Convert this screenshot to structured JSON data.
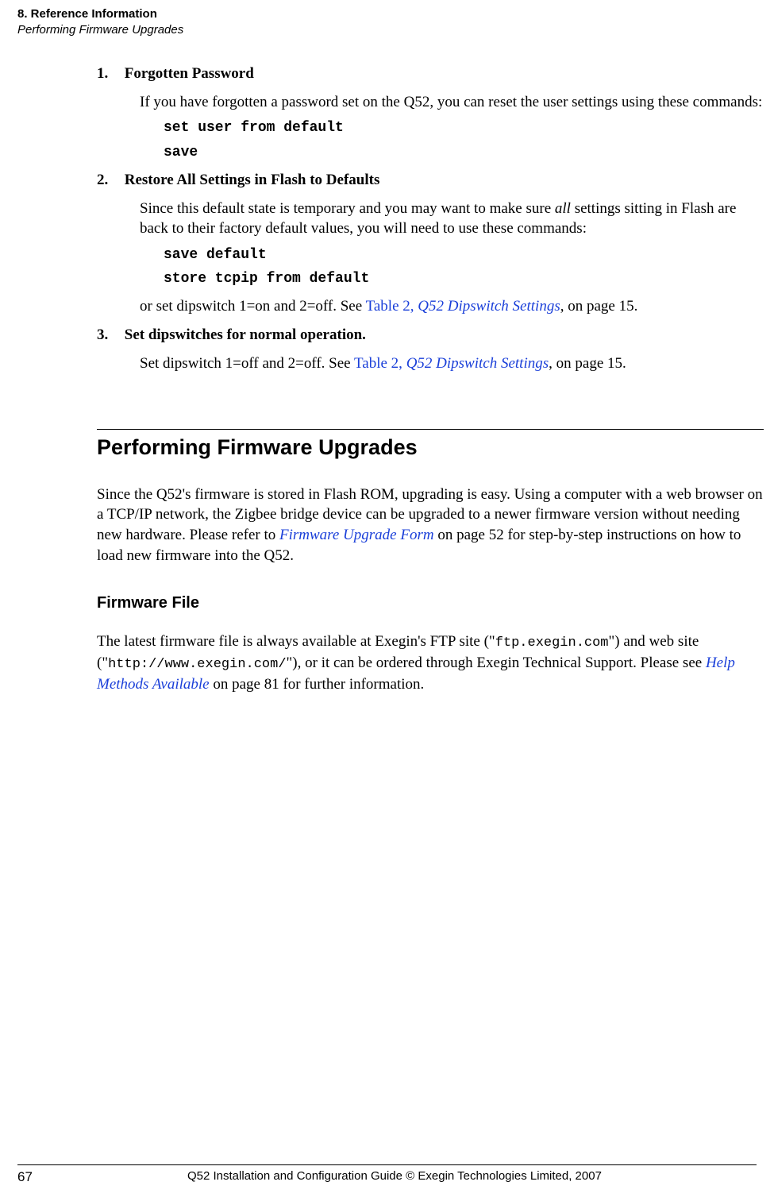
{
  "header": {
    "line1": "8. Reference Information",
    "line2": "Performing Firmware Upgrades"
  },
  "items": {
    "item1": {
      "num": "1.",
      "title": "Forgotten Password",
      "body": "If you have forgotten a password set on the Q52, you can reset the user settings using these commands:",
      "code1": "set user from default",
      "code2": "save"
    },
    "item2": {
      "num": "2.",
      "title": "Restore All Settings in Flash to Defaults",
      "body_a": "Since this default state is temporary and you may want to make sure ",
      "body_all": "all",
      "body_b": " settings sitting in Flash are back to their factory default values, you will need to use these commands:",
      "code1": "save default",
      "code2": "store tcpip from default",
      "tail_a": "or set dipswitch 1=on and 2=off. See ",
      "link_a": "Table 2, ",
      "link_b": "Q52 Dipswitch Settings",
      "tail_b": ", on page 15."
    },
    "item3": {
      "num": "3.",
      "title": "Set dipswitches for normal operation.",
      "body_a": "Set dipswitch 1=off and 2=off. See ",
      "link_a": "Table 2, ",
      "link_b": "Q52 Dipswitch Settings",
      "body_b": ", on page 15."
    }
  },
  "section": {
    "heading": "Performing Firmware Upgrades",
    "body_a": "Since the Q52's firmware is stored in Flash ROM, upgrading is easy. Using a computer with a web browser on a TCP/IP network, the Zigbee bridge device can be upgraded to a newer firmware version without needing new hardware. Please refer to ",
    "link": "Firmware Upgrade Form",
    "body_b": " on page 52 for step-by-step instructions on how to load new firmware into the Q52."
  },
  "subsection": {
    "heading": "Firmware File",
    "body_a": "The latest firmware file is always available at Exegin's FTP site (\"",
    "mono1": "ftp.exegin.com",
    "body_b": "\") and web site (\"",
    "mono2": "http://www.exegin.com/",
    "body_c": "\"), or it can be ordered through Exegin Technical Support. Please see ",
    "link": "Help Methods Available",
    "body_d": " on page 81 for further information."
  },
  "footer": {
    "page": "67",
    "text": "Q52 Installation and Configuration Guide  © Exegin Technologies Limited, 2007"
  }
}
